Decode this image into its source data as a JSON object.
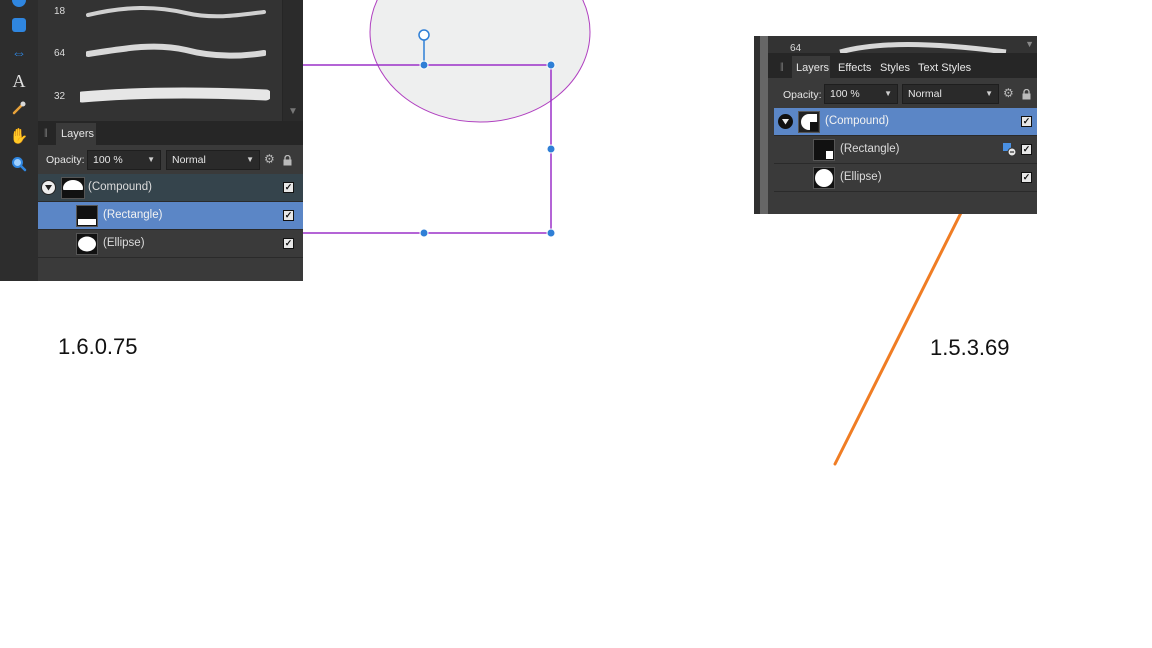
{
  "left": {
    "toolbar": {
      "tools": [
        {
          "icon": "shape-tool-icon"
        },
        {
          "icon": "rectangle-tool-icon"
        },
        {
          "icon": "move-tool-icon"
        },
        {
          "icon": "text-tool-icon",
          "glyph": "A"
        },
        {
          "icon": "eyedropper-tool-icon"
        },
        {
          "icon": "hand-tool-icon",
          "glyph": "✋"
        },
        {
          "icon": "zoom-tool-icon"
        }
      ]
    },
    "brushes": [
      {
        "size": "18"
      },
      {
        "size": "64"
      },
      {
        "size": "32"
      }
    ],
    "layers_panel": {
      "tab": "Layers",
      "opacity_label": "Opacity:",
      "opacity_value": "100 %",
      "blend_mode": "Normal",
      "layers": [
        {
          "name": "(Compound)",
          "checked": true
        },
        {
          "name": "(Rectangle)",
          "checked": true,
          "selected": true
        },
        {
          "name": "(Ellipse)",
          "checked": true
        }
      ]
    },
    "version": "1.6.0.75"
  },
  "right": {
    "brush_size": "64",
    "layers_panel": {
      "tabs": [
        "Layers",
        "Effects",
        "Styles",
        "Text Styles"
      ],
      "opacity_label": "Opacity:",
      "opacity_value": "100 %",
      "blend_mode": "Normal",
      "layers": [
        {
          "name": "(Compound)",
          "checked": true,
          "selected": true
        },
        {
          "name": "(Rectangle)",
          "checked": true
        },
        {
          "name": "(Ellipse)",
          "checked": true
        }
      ]
    },
    "version": "1.5.3.69"
  },
  "colors": {
    "selection_purple": "#9b30c8",
    "handle_blue": "#2f7fd6",
    "selected_row": "#5b86c6",
    "annotation_orange": "#f07d24"
  }
}
